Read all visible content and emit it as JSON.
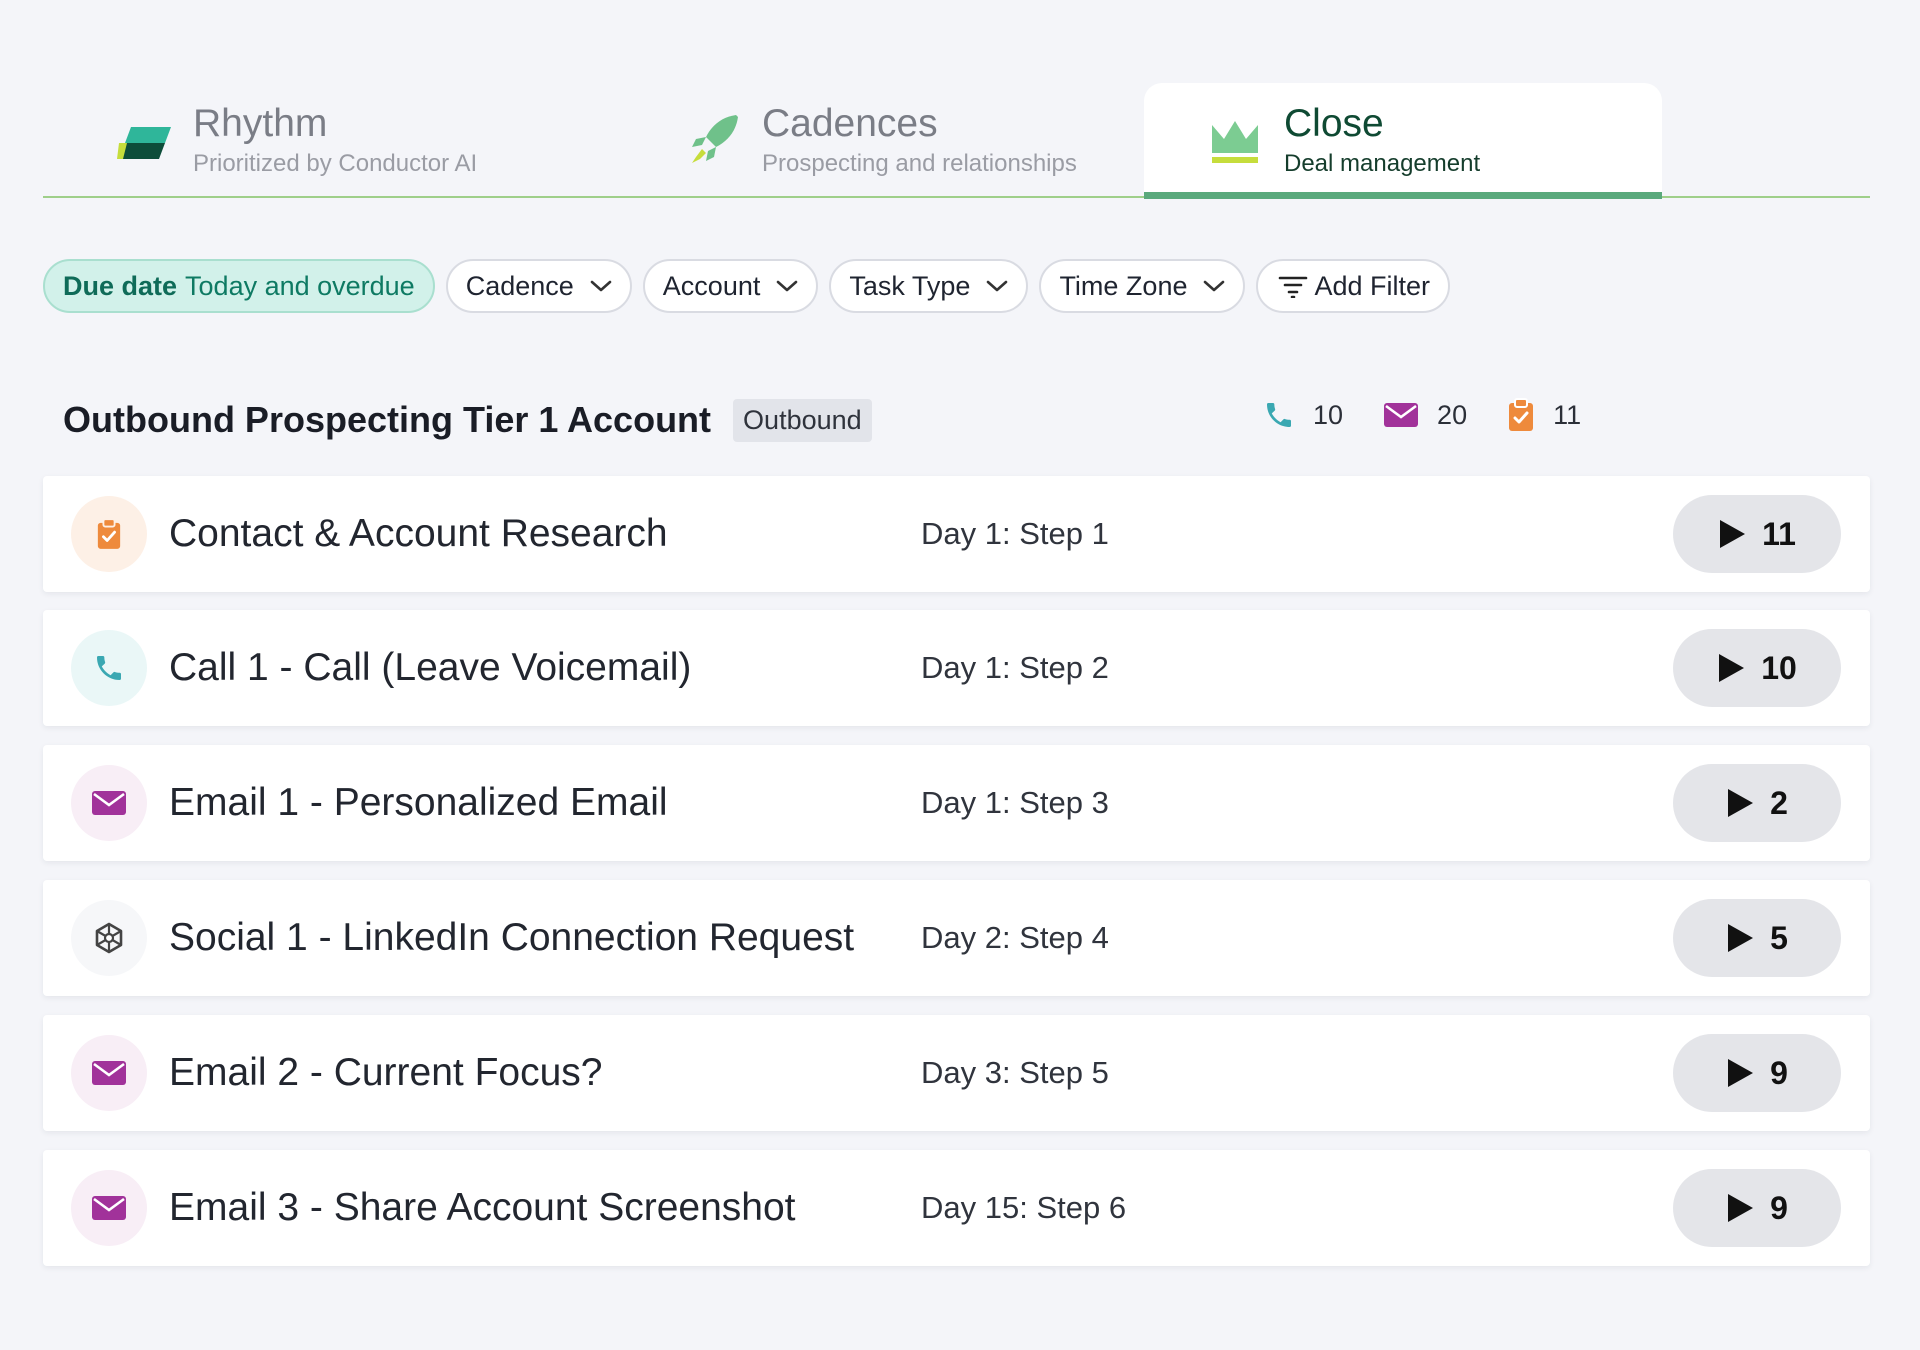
{
  "tabs": [
    {
      "title": "Rhythm",
      "subtitle": "Prioritized by Conductor AI",
      "icon": "rhythm-logo-icon",
      "active": false
    },
    {
      "title": "Cadences",
      "subtitle": "Prospecting and relationships",
      "icon": "rocket-icon",
      "active": false
    },
    {
      "title": "Close",
      "subtitle": "Deal management",
      "icon": "crown-icon",
      "active": true
    }
  ],
  "filters": {
    "due": {
      "label": "Due date",
      "value": "Today and overdue"
    },
    "cadence": "Cadence",
    "account": "Account",
    "task_type": "Task Type",
    "time_zone": "Time Zone",
    "add_filter": "Add Filter"
  },
  "cadence": {
    "title": "Outbound Prospecting Tier 1 Account",
    "badge": "Outbound",
    "counts": {
      "calls": "10",
      "emails": "20",
      "tasks": "11"
    }
  },
  "steps": [
    {
      "type": "task",
      "icon": "clipboard-check-icon",
      "name": "Contact & Account Research",
      "day": "Day 1: Step 1",
      "count": "11"
    },
    {
      "type": "call",
      "icon": "phone-icon",
      "name": "Call 1 - Call (Leave Voicemail)",
      "day": "Day 1: Step 2",
      "count": "10"
    },
    {
      "type": "email",
      "icon": "envelope-icon",
      "name": "Email 1 - Personalized Email",
      "day": "Day 1: Step 3",
      "count": "2"
    },
    {
      "type": "social",
      "icon": "social-network-icon",
      "name": "Social 1 - LinkedIn Connection Request",
      "day": "Day 2: Step 4",
      "count": "5"
    },
    {
      "type": "email",
      "icon": "envelope-icon",
      "name": "Email 2 - Current Focus?",
      "day": "Day 3: Step 5",
      "count": "9"
    },
    {
      "type": "email",
      "icon": "envelope-icon",
      "name": "Email 3 - Share Account Screenshot",
      "day": "Day 15: Step 6",
      "count": "9"
    }
  ],
  "colors": {
    "accent_green": "#5aa97c",
    "call_teal": "#3aa8b2",
    "email_purple": "#a1329a",
    "task_orange": "#ee8a3c",
    "due_chip_bg": "#d2f1ea"
  }
}
